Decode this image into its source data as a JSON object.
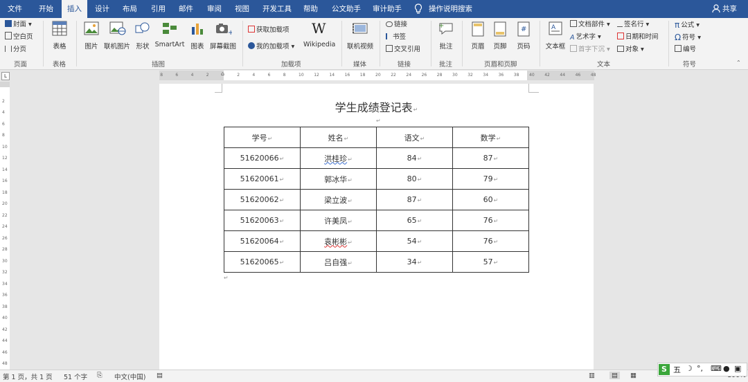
{
  "menu": {
    "tabs": [
      "文件",
      "开始",
      "插入",
      "设计",
      "布局",
      "引用",
      "邮件",
      "审阅",
      "视图",
      "开发工具",
      "帮助",
      "公文助手",
      "审计助手"
    ],
    "search": "操作说明搜索",
    "share": "共享"
  },
  "ribbon": {
    "page_group": {
      "cover": "封面",
      "blank": "空白页",
      "break": "分页",
      "label": "页面"
    },
    "table_group": {
      "table": "表格",
      "label": "表格"
    },
    "illustrations": {
      "picture": "图片",
      "online_picture": "联机图片",
      "shapes": "形状",
      "smartart": "SmartArt",
      "chart": "图表",
      "screenshot": "屏幕截图",
      "label": "插图"
    },
    "addins": {
      "get": "获取加载项",
      "my": "我的加载项",
      "wikipedia": "Wikipedia",
      "label": "加载项"
    },
    "media": {
      "online_video": "联机视频",
      "label": "媒体"
    },
    "links": {
      "link": "链接",
      "bookmark": "书签",
      "crossref": "交叉引用",
      "label": "链接"
    },
    "comments": {
      "comment": "批注",
      "label": "批注"
    },
    "header_footer": {
      "header": "页眉",
      "footer": "页脚",
      "page_number": "页码",
      "label": "页眉和页脚"
    },
    "text": {
      "textbox": "文本框",
      "quickparts": "文档部件",
      "wordart": "艺术字",
      "dropcap": "首字下沉",
      "signature": "签名行",
      "datetime": "日期和时间",
      "object": "对象",
      "label": "文本"
    },
    "symbols": {
      "equation": "公式",
      "symbol": "符号",
      "number": "编号",
      "label": "符号"
    }
  },
  "ruler": {
    "left_ticks": [
      "8",
      "6",
      "4",
      "2"
    ],
    "ticks": [
      "2",
      "4",
      "6",
      "8",
      "10",
      "12",
      "14",
      "16",
      "18",
      "20",
      "22",
      "24",
      "26",
      "28",
      "30",
      "32",
      "34",
      "36",
      "38",
      "40",
      "42",
      "44",
      "46",
      "48"
    ]
  },
  "document": {
    "title": "学生成绩登记表",
    "headers": [
      "学号",
      "姓名",
      "语文",
      "数学"
    ],
    "rows": [
      [
        "51620066",
        "洪桂珍",
        "84",
        "87"
      ],
      [
        "51620061",
        "郭冰华",
        "80",
        "79"
      ],
      [
        "51620062",
        "梁立波",
        "87",
        "60"
      ],
      [
        "51620063",
        "许美凤",
        "65",
        "76"
      ],
      [
        "51620064",
        "袁彬彬",
        "54",
        "76"
      ],
      [
        "51620065",
        "吕自强",
        "34",
        "57"
      ]
    ]
  },
  "status": {
    "page": "第 1 页，共 1 页",
    "words": "51 个字",
    "language": "中文(中国)",
    "zoom": "100%",
    "ime": "五"
  }
}
